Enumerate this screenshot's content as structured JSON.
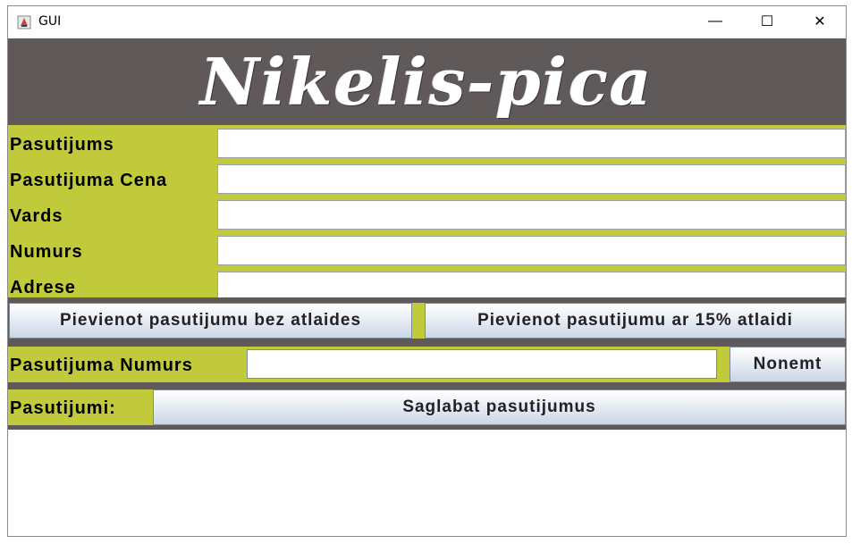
{
  "window": {
    "title": "GUI",
    "controls": {
      "minimize": "—",
      "maximize": "☐",
      "close": "✕"
    }
  },
  "header": {
    "logo_text": "Nikelis-pica"
  },
  "form": {
    "rows": [
      {
        "label": "Pasutijums",
        "value": ""
      },
      {
        "label": "Pasutijuma Cena",
        "value": ""
      },
      {
        "label": "Vards",
        "value": ""
      },
      {
        "label": "Numurs",
        "value": ""
      },
      {
        "label": "Adrese",
        "value": ""
      }
    ]
  },
  "actions": {
    "add_no_discount": "Pievienot pasutijumu bez atlaides",
    "add_discount": "Pievienot pasutijumu ar 15% atlaidi"
  },
  "remove": {
    "label": "Pasutijuma Numurs",
    "value": "",
    "button": "Nonemt"
  },
  "orders": {
    "label": "Pasutijumi:",
    "save_button": "Saglabat pasutijumus"
  },
  "colors": {
    "accent_green": "#c0ca3a",
    "dark_gray": "#5f595a"
  }
}
